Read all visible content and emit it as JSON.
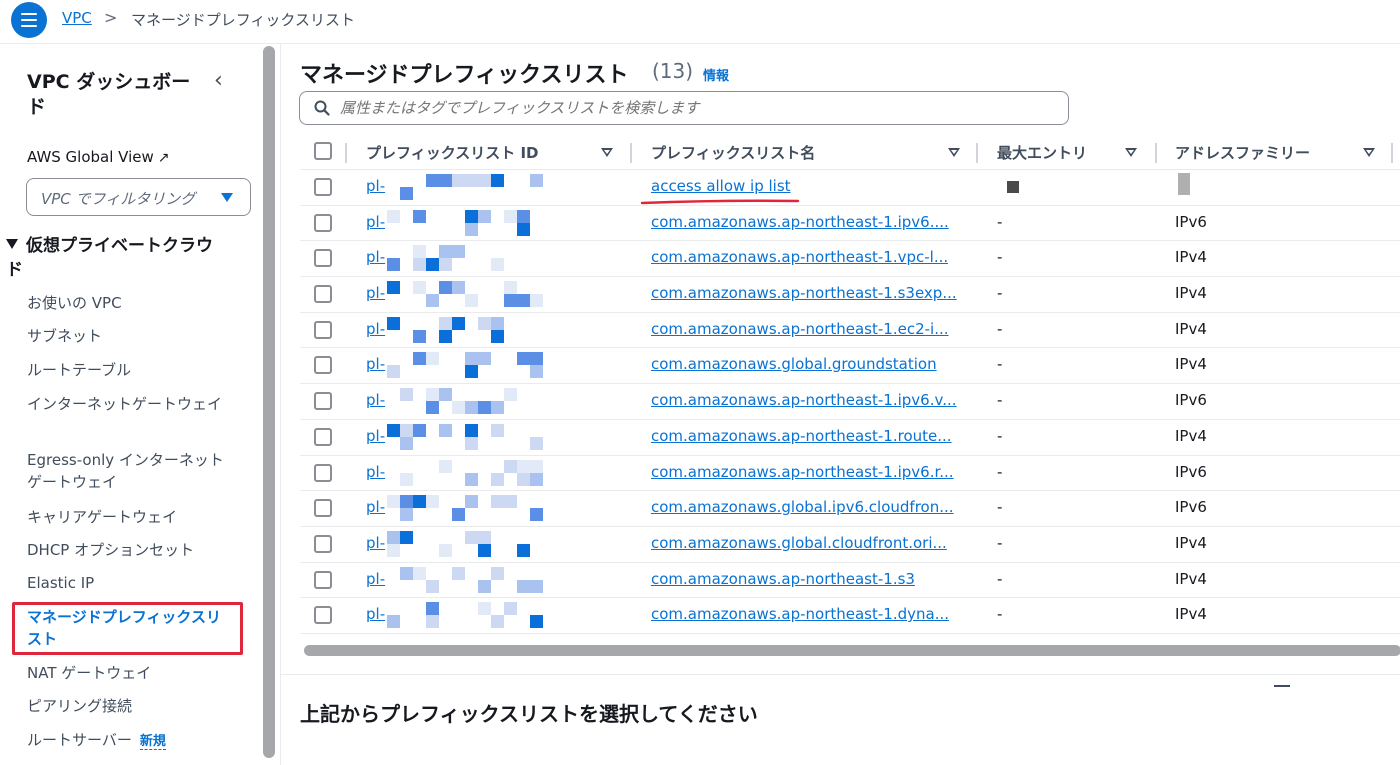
{
  "breadcrumb": {
    "root": "VPC",
    "separator": ">",
    "current": "マネージドプレフィックスリスト"
  },
  "sidebar": {
    "title": "VPC ダッシュボード",
    "collapse_icon": "chevron-left-icon",
    "global_view": "AWS Global View",
    "filter_placeholder": "VPC でフィルタリング",
    "section": "仮想プライベートクラウド",
    "items": [
      {
        "label": "お使いの VPC"
      },
      {
        "label": "サブネット"
      },
      {
        "label": "ルートテーブル"
      },
      {
        "label": "インターネットゲートウェイ"
      },
      {
        "label": "Egress-only インターネットゲートウェイ"
      },
      {
        "label": "キャリアゲートウェイ"
      },
      {
        "label": "DHCP オプションセット"
      },
      {
        "label": "Elastic IP"
      },
      {
        "label": "マネージドプレフィックスリスト",
        "active": true
      },
      {
        "label": "NAT ゲートウェイ"
      },
      {
        "label": "ピアリング接続"
      },
      {
        "label": "ルートサーバー",
        "badge": "新規"
      }
    ]
  },
  "main": {
    "title": "マネージドプレフィックスリスト",
    "count": "(13)",
    "info": "情報",
    "search_placeholder": "属性またはタグでプレフィックスリストを検索します",
    "columns": [
      "プレフィックスリスト ID",
      "プレフィックスリスト名",
      "最大エントリ",
      "アドレスファミリー"
    ],
    "rows": [
      {
        "id": "pl-",
        "name": "access allow ip list",
        "max": "",
        "family": ""
      },
      {
        "id": "pl-",
        "name": "com.amazonaws.ap-northeast-1.ipv6....",
        "max": "-",
        "family": "IPv6"
      },
      {
        "id": "pl-",
        "name": "com.amazonaws.ap-northeast-1.vpc-l...",
        "max": "-",
        "family": "IPv4"
      },
      {
        "id": "pl-",
        "name": "com.amazonaws.ap-northeast-1.s3exp...",
        "max": "-",
        "family": "IPv4"
      },
      {
        "id": "pl-",
        "name": "com.amazonaws.ap-northeast-1.ec2-i...",
        "max": "-",
        "family": "IPv4"
      },
      {
        "id": "pl-",
        "name": "com.amazonaws.global.groundstation",
        "max": "-",
        "family": "IPv4"
      },
      {
        "id": "pl-",
        "name": "com.amazonaws.ap-northeast-1.ipv6.v...",
        "max": "-",
        "family": "IPv6"
      },
      {
        "id": "pl-",
        "name": "com.amazonaws.ap-northeast-1.route...",
        "max": "-",
        "family": "IPv4"
      },
      {
        "id": "pl-",
        "name": "com.amazonaws.ap-northeast-1.ipv6.r...",
        "max": "-",
        "family": "IPv6"
      },
      {
        "id": "pl-",
        "name": "com.amazonaws.global.ipv6.cloudfron...",
        "max": "-",
        "family": "IPv6"
      },
      {
        "id": "pl-",
        "name": "com.amazonaws.global.cloudfront.ori...",
        "max": "-",
        "family": "IPv4"
      },
      {
        "id": "pl-",
        "name": "com.amazonaws.ap-northeast-1.s3",
        "max": "-",
        "family": "IPv4"
      },
      {
        "id": "pl-",
        "name": "com.amazonaws.ap-northeast-1.dyna...",
        "max": "-",
        "family": "IPv4"
      }
    ],
    "bottom_title": "上記からプレフィックスリストを選択してください"
  },
  "colors": {
    "link": "#0972d3",
    "highlight": "#e0263a"
  }
}
